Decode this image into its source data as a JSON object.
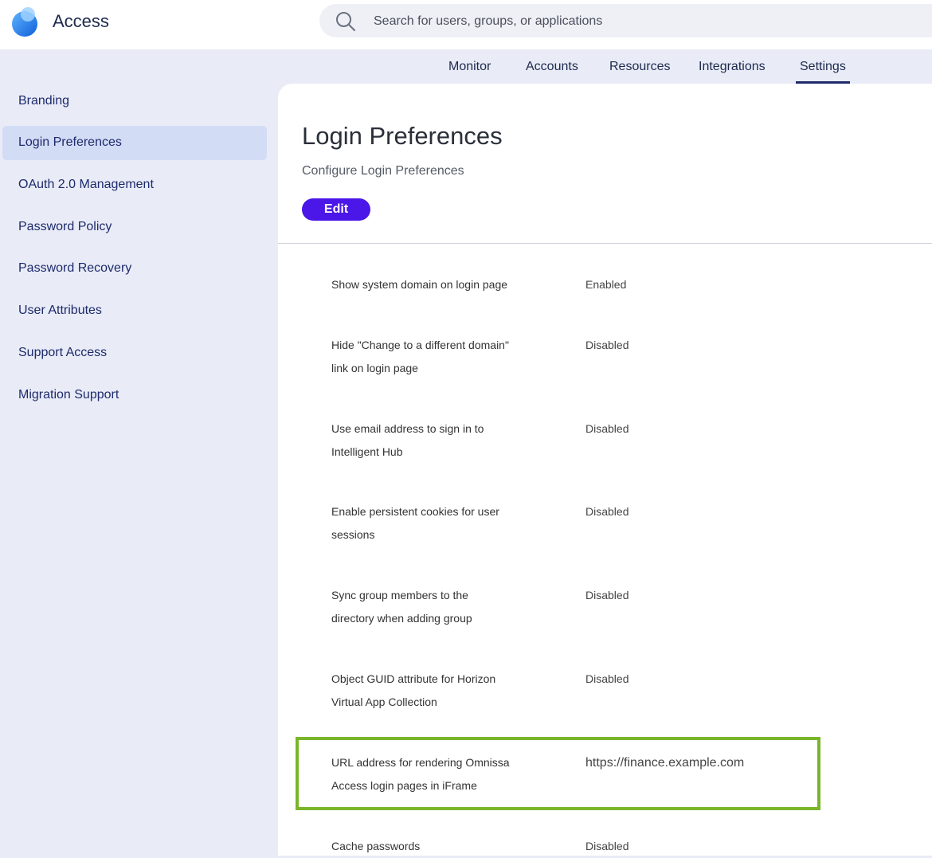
{
  "header": {
    "app_title": "Access",
    "search_placeholder": "Search for users, groups, or applications"
  },
  "topnav": {
    "tabs": [
      {
        "label": "Monitor",
        "active": false
      },
      {
        "label": "Accounts",
        "active": false
      },
      {
        "label": "Resources",
        "active": false
      },
      {
        "label": "Integrations",
        "active": false
      },
      {
        "label": "Settings",
        "active": true
      }
    ]
  },
  "sidebar": {
    "items": [
      {
        "label": "Branding",
        "active": false
      },
      {
        "label": "Login Preferences",
        "active": true
      },
      {
        "label": "OAuth 2.0 Management",
        "active": false
      },
      {
        "label": "Password Policy",
        "active": false
      },
      {
        "label": "Password Recovery",
        "active": false
      },
      {
        "label": "User Attributes",
        "active": false
      },
      {
        "label": "Support Access",
        "active": false
      },
      {
        "label": "Migration Support",
        "active": false
      }
    ]
  },
  "main": {
    "title": "Login Preferences",
    "subtitle": "Configure Login Preferences",
    "edit_label": "Edit",
    "settings": [
      {
        "label_line1": "Show system domain on login page",
        "label_line2": "",
        "value": "Enabled"
      },
      {
        "label_line1": "Hide \"Change to a different domain\"",
        "label_line2": "link on login page",
        "value": "Disabled"
      },
      {
        "label_line1": "Use email address to sign in to",
        "label_line2": "Intelligent Hub",
        "value": "Disabled"
      },
      {
        "label_line1": "Enable persistent cookies for user",
        "label_line2": "sessions",
        "value": "Disabled"
      },
      {
        "label_line1": "Sync group members to the",
        "label_line2": "directory when adding group",
        "value": "Disabled"
      },
      {
        "label_line1": "Object GUID attribute for Horizon",
        "label_line2": "Virtual App Collection",
        "value": "Disabled"
      },
      {
        "label_line1": "URL address for rendering Omnissa",
        "label_line2": "Access login pages in iFrame",
        "value": "https://finance.example.com"
      },
      {
        "label_line1": "Cache passwords",
        "label_line2": "",
        "value": "Disabled"
      }
    ]
  },
  "colors": {
    "accent": "#4b16e8",
    "highlight_border": "#7ab52a",
    "sidebar_active": "#d3dcf5",
    "nav_text": "#1d2a6b"
  },
  "icons": {
    "logo": "access-logo-icon",
    "search": "search-icon"
  }
}
